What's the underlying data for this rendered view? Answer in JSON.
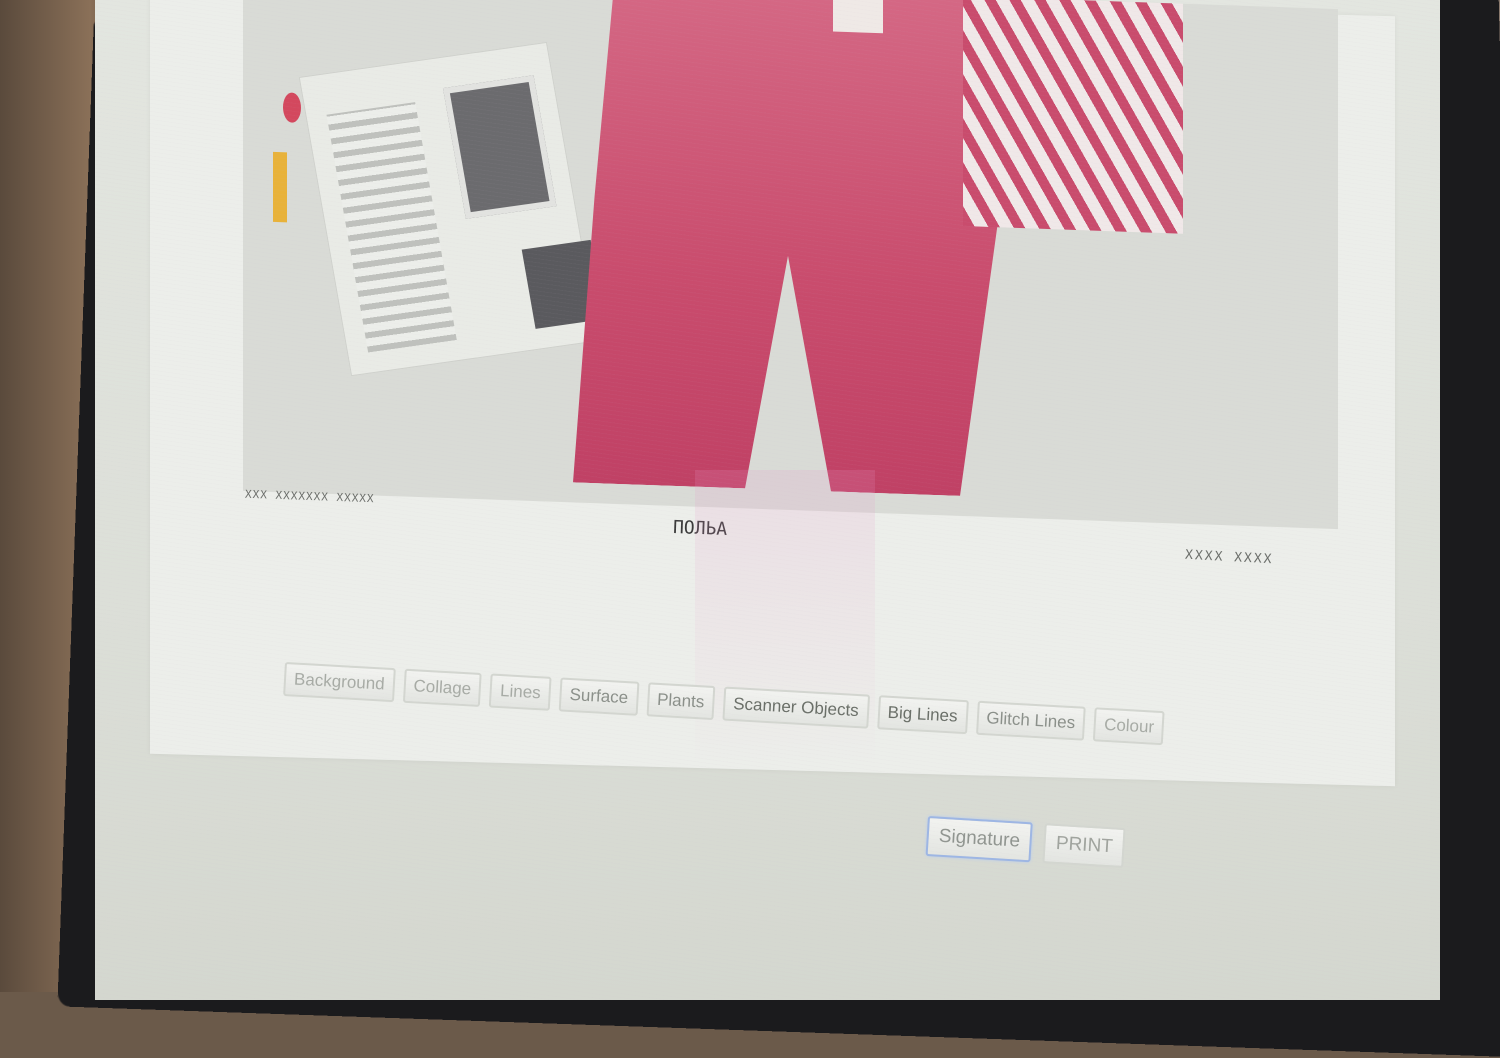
{
  "artwork": {
    "caption_left": "XXX XXXXXXX XXXXX",
    "signature": "ПОЛЬА",
    "caption_right": "XXXX XXXX"
  },
  "toolbar": {
    "buttons": [
      "Background",
      "Collage",
      "Lines",
      "Surface",
      "Plants",
      "Scanner Objects",
      "Big Lines",
      "Glitch Lines",
      "Colour"
    ]
  },
  "actions": {
    "signature_label": "Signature",
    "print_label": "PRINT"
  },
  "colors": {
    "accent_pink": "#c94c6d",
    "focus_ring": "#9db6e4"
  }
}
